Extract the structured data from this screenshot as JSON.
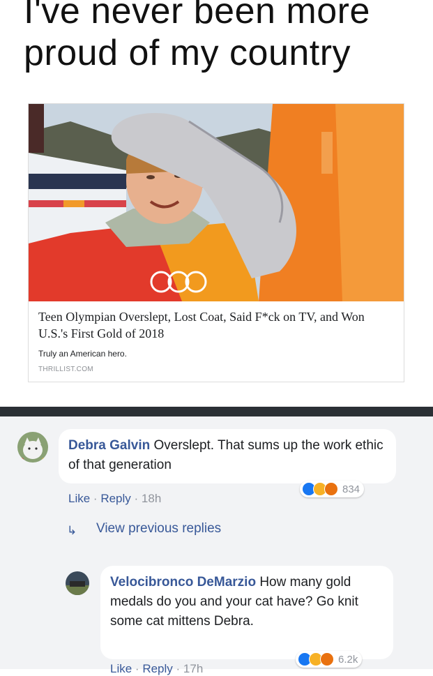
{
  "meme": {
    "line1": "I've never been more",
    "line2": "proud of my country"
  },
  "article": {
    "headline": "Teen Olympian Overslept, Lost Coat, Said F*ck on TV, and Won U.S.'s First Gold of 2018",
    "subtitle": "Truly an American hero.",
    "source": "THRILLIST.COM"
  },
  "comments": [
    {
      "author": "Debra Galvin",
      "text": "Overslept. That sums up the work ethic of that generation",
      "like_label": "Like",
      "reply_label": "Reply",
      "time": "18h",
      "reaction_count": "834"
    },
    {
      "author": "Velocibronco DeMarzio",
      "text": "How many gold medals do you and your cat have? Go knit some cat mittens Debra.",
      "like_label": "Like",
      "reply_label": "Reply",
      "time": "17h",
      "reaction_count": "6.2k"
    }
  ],
  "view_previous_replies": "View previous replies",
  "colors": {
    "link": "#385898",
    "muted": "#90949c",
    "comment_bg": "#f2f3f5",
    "like_blue": "#1877f2",
    "haha_yellow": "#f7b125",
    "angry_red": "#e9710f"
  }
}
